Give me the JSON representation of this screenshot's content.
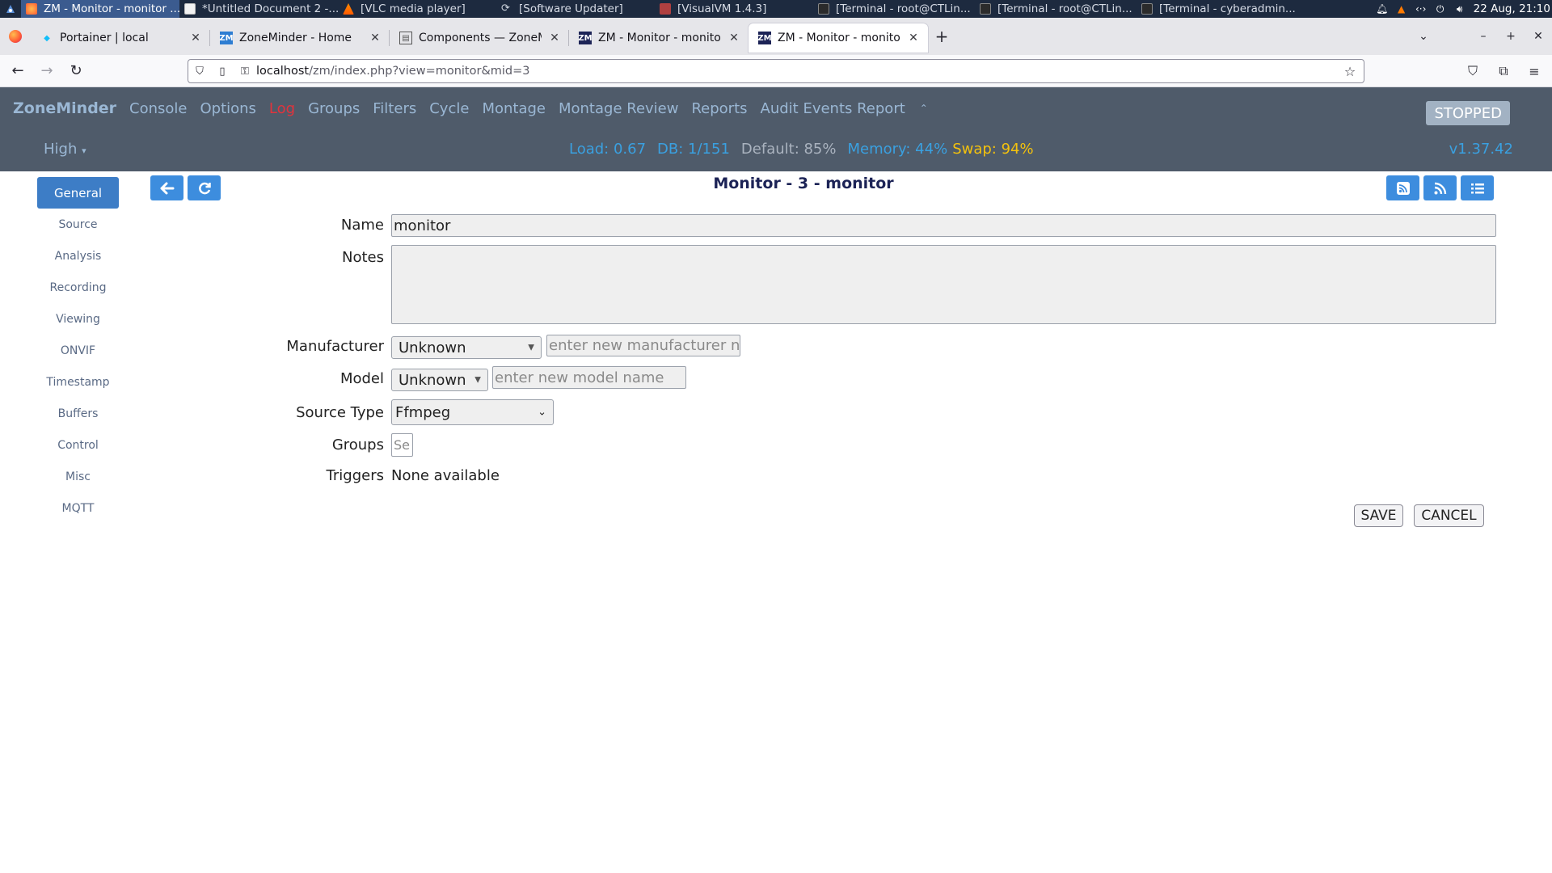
{
  "taskbar": {
    "tasks": [
      {
        "label": "ZM - Monitor - monitor ...",
        "active": true
      },
      {
        "label": "*Untitled Document 2 -..."
      },
      {
        "label": "[VLC media player]"
      },
      {
        "label": "[Software Updater]"
      },
      {
        "label": "[VisualVM 1.4.3]"
      },
      {
        "label": "[Terminal - root@CTLin..."
      },
      {
        "label": "[Terminal - root@CTLin..."
      },
      {
        "label": "[Terminal - cyberadmin..."
      }
    ],
    "clock": "22 Aug, 21:10"
  },
  "browser": {
    "tabs": [
      {
        "title": "Portainer | local",
        "icon": "portainer-icon"
      },
      {
        "title": "ZoneMinder - Home",
        "icon": "zm-icon"
      },
      {
        "title": "Components — ZoneMin",
        "icon": "docs-icon"
      },
      {
        "title": "ZM - Monitor - monitor",
        "icon": "zm-icon"
      },
      {
        "title": "ZM - Monitor - monitor",
        "icon": "zm-icon",
        "selected": true
      }
    ],
    "url_host": "localhost",
    "url_rest": "/zm/index.php?view=monitor&mid=3"
  },
  "zm": {
    "brand": "ZoneMinder",
    "menu": [
      "Console",
      "Options",
      "Log",
      "Groups",
      "Filters",
      "Cycle",
      "Montage",
      "Montage Review",
      "Reports",
      "Audit Events Report"
    ],
    "status": "STOPPED",
    "bandwidth": "High",
    "stats": {
      "load": "Load: 0.67",
      "db": "DB: 1/151",
      "default": "Default: 85%",
      "memory": "Memory: 44%",
      "swap": "Swap: 94%"
    },
    "version": "v1.37.42"
  },
  "page": {
    "title": "Monitor - 3 - monitor",
    "sidebar": [
      "General",
      "Source",
      "Analysis",
      "Recording",
      "Viewing",
      "ONVIF",
      "Timestamp",
      "Buffers",
      "Control",
      "Misc",
      "MQTT"
    ],
    "form": {
      "name_label": "Name",
      "name_value": "monitor",
      "notes_label": "Notes",
      "notes_value": "",
      "manufacturer_label": "Manufacturer",
      "manufacturer_value": "Unknown",
      "manufacturer_placeholder": "enter new manufacturer name",
      "model_label": "Model",
      "model_value": "Unknown",
      "model_placeholder": "enter new model name",
      "source_type_label": "Source Type",
      "source_type_value": "Ffmpeg",
      "groups_label": "Groups",
      "groups_placeholder": "Se",
      "triggers_label": "Triggers",
      "triggers_value": "None available"
    },
    "save": "SAVE",
    "cancel": "CANCEL"
  },
  "colors": {
    "header_bg": "#4f5b6a",
    "accent": "#3d8dde",
    "log_red": "#e2333c",
    "swap_warn": "#f4c20d"
  }
}
